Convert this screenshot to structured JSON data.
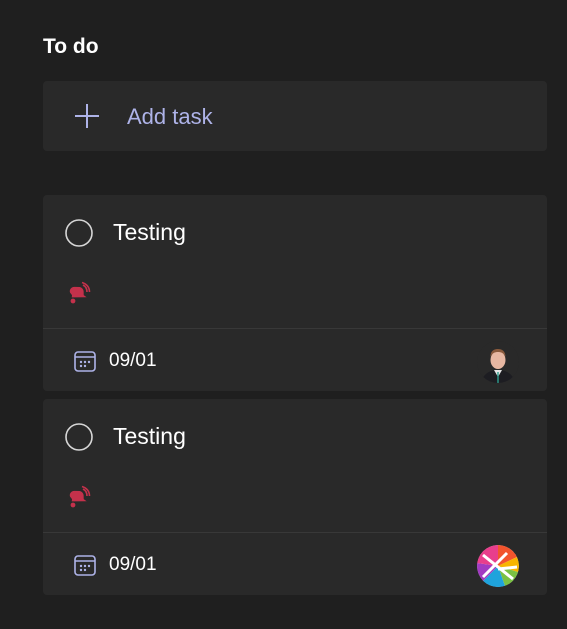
{
  "column": {
    "title": "To do",
    "add_task_label": "Add task"
  },
  "tasks": [
    {
      "title": "Testing",
      "due": "09/01",
      "priority_icon": "urgent-bell-icon",
      "priority_color": "#c4314b",
      "assignee_avatar": "person-photo"
    },
    {
      "title": "Testing",
      "due": "09/01",
      "priority_icon": "urgent-bell-icon",
      "priority_color": "#c4314b",
      "assignee_avatar": "colorful-logo"
    }
  ],
  "colors": {
    "background": "#1f1f1f",
    "card": "#292929",
    "accent": "#aeb3e8",
    "priority_urgent": "#c4314b"
  }
}
